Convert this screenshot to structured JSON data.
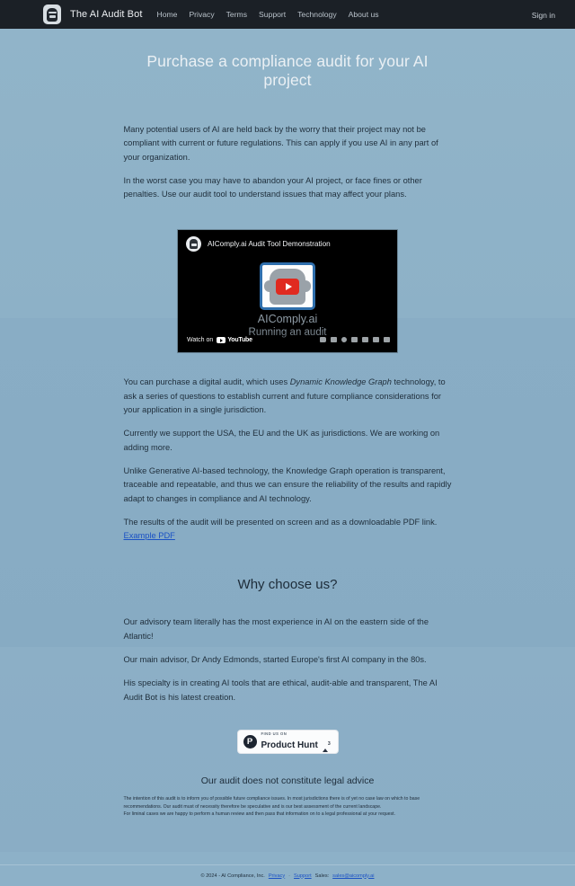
{
  "navbar": {
    "brand": "The AI Audit Bot",
    "logo_icon": "robot-head-icon",
    "links": [
      {
        "label": "Home"
      },
      {
        "label": "Privacy"
      },
      {
        "label": "Terms"
      },
      {
        "label": "Support"
      },
      {
        "label": "Technology"
      },
      {
        "label": "About us"
      }
    ],
    "signin_label": "Sign in",
    "bg_color": "#1b2026"
  },
  "hero": {
    "title": "Purchase a compliance audit for your AI project",
    "paragraph_1": "Many potential users of AI are held back by the worry that their project may not be compliant with current or future regulations. This can apply if you use AI in any part of your organization.",
    "paragraph_2": "In the worst case you may have to abandon your AI project, or face fines or other penalties. Use our audit tool to understand issues that may affect your plans."
  },
  "video": {
    "title": "AIComply.ai Audit Tool Demonstration",
    "channel_avatar_icon": "robot-head-icon",
    "play_icon": "youtube-play-icon",
    "overlay_line_1": "AIComply.ai",
    "overlay_line_2": "Running an audit",
    "watch_on_label": "Watch on",
    "youtube_wordmark": "YouTube",
    "controls": [
      "volume-icon",
      "subtitles-icon",
      "settings-icon",
      "autoplay-icon",
      "miniplayer-icon",
      "theater-icon",
      "fullscreen-icon"
    ]
  },
  "details": {
    "para_1_a": "You can purchase a digital audit, which uses ",
    "para_1_em": "Dynamic Knowledge Graph",
    "para_1_b": " technology, to ask a series of questions to establish current and future compliance considerations for your application in a single jurisdiction.",
    "para_2": "Currently we support the USA, the EU and the UK as jurisdictions. We are working on adding more.",
    "para_3": "Unlike Generative AI-based technology, the Knowledge Graph operation is transparent, traceable and repeatable, and thus we can ensure the reliability of the results and rapidly adapt to changes in compliance and AI technology.",
    "para_4_a": "The results of the audit will be presented on screen and as a downloadable PDF link. ",
    "para_4_link": "Example PDF"
  },
  "why_choose": {
    "title": "Why choose us?",
    "line_1": "Our advisory team literally has the most experience in AI on the eastern side of the Atlantic!",
    "line_2": "Our main advisor, Dr Andy Edmonds, started Europe's first AI company in the 80s.",
    "line_3": "His specialty is in creating AI tools that are ethical, audit-able and transparent, The AI Audit Bot is his latest creation."
  },
  "product_hunt": {
    "mark": "P",
    "kicker": "FIND US ON",
    "name": "Product Hunt",
    "upvote_icon": "upvote-arrow-icon",
    "count": "3"
  },
  "disclaimer": {
    "title": "Our audit does not constitute legal advice",
    "line_1": "The intention of this audit is to inform you of possible future compliance issues. In most jurisdictions there is of yet no case law on which to base",
    "line_2": "recommendations. Our audit must of necessity therefore be speculative and is our best assessment of the current landscape.",
    "line_3": "For liminal cases we are happy to perform a human review and then pass that information on to a legal professional at your request."
  },
  "footer": {
    "copyright": "© 2024 - AI Compliance, Inc.",
    "privacy_label": "Privacy",
    "support_label": "Support",
    "sales_label": "Sales:",
    "sales_email": "sales@aicomply.ai"
  },
  "colors": {
    "background_top": "#8fb2c8",
    "navbar": "#1b2026",
    "link": "#1b52c4",
    "heading_light": "#eaf0f4"
  }
}
